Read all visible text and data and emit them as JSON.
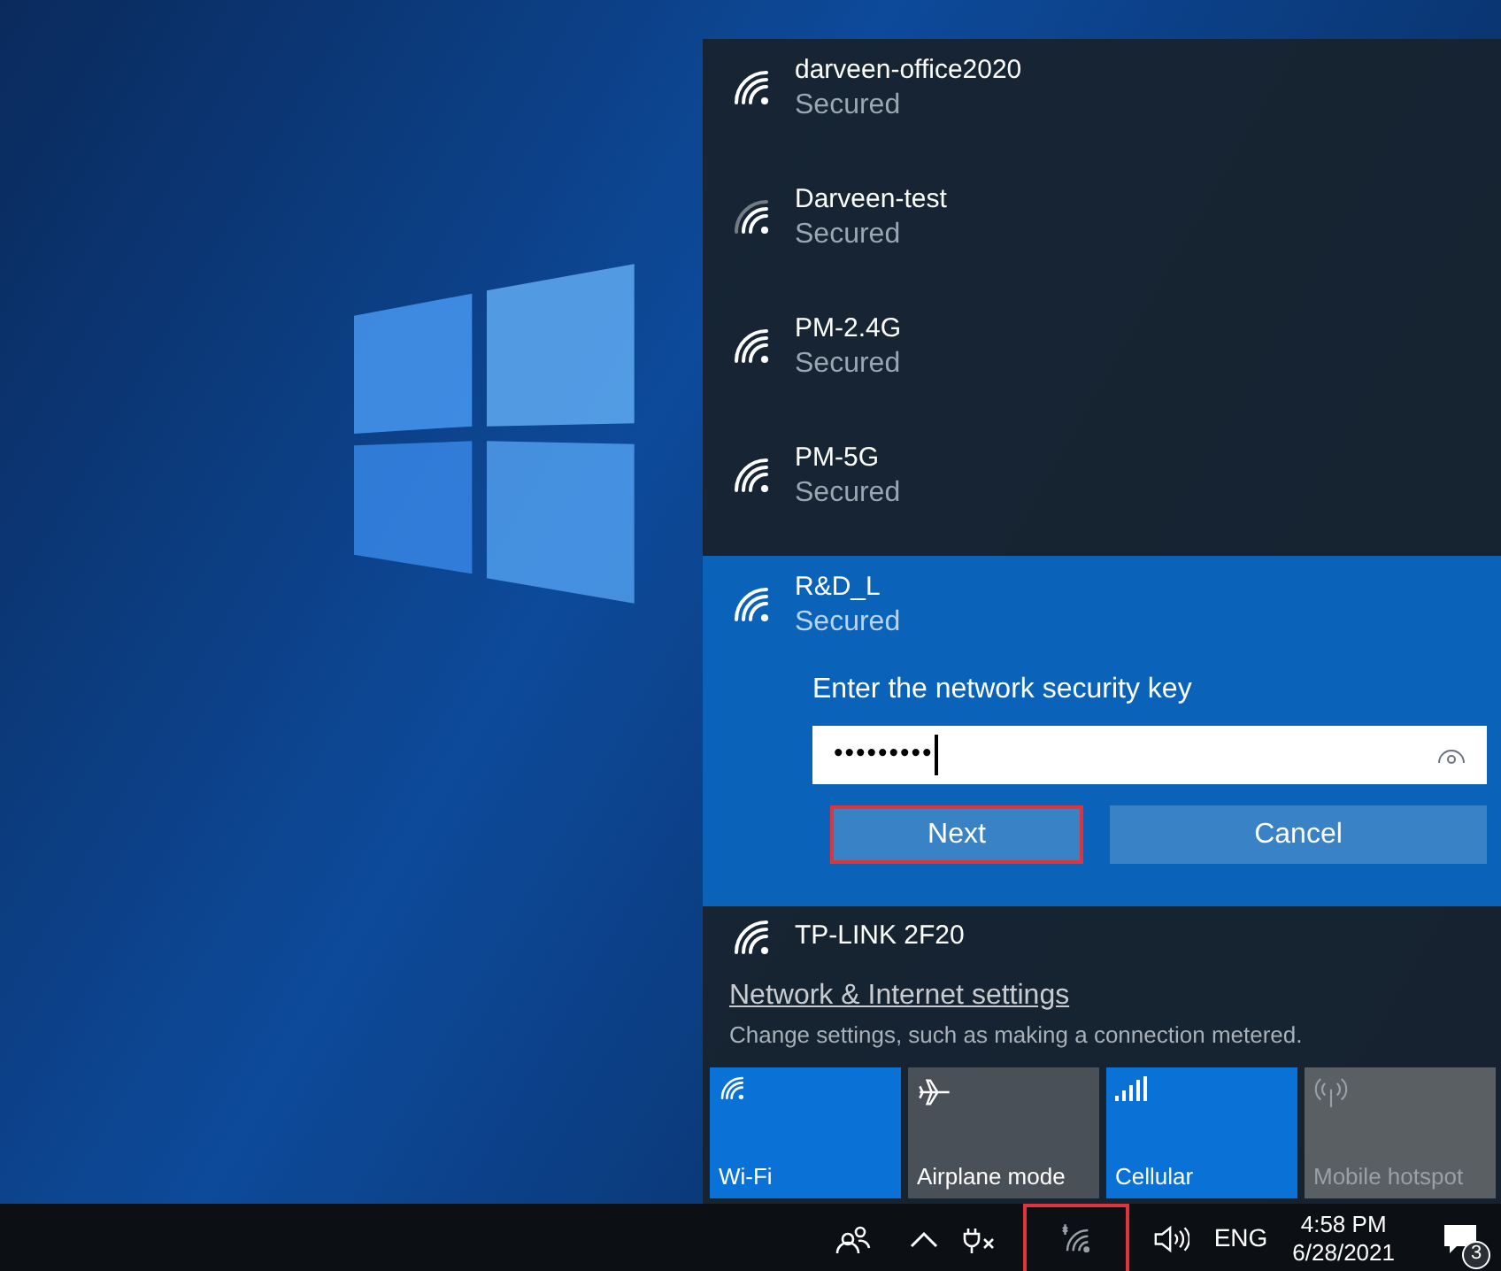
{
  "networks": [
    {
      "name": "darveen-office2020",
      "status": "Secured",
      "weak_signal": false
    },
    {
      "name": "Darveen-test",
      "status": "Secured",
      "weak_signal": true
    },
    {
      "name": "PM-2.4G",
      "status": "Secured",
      "weak_signal": false
    },
    {
      "name": "PM-5G",
      "status": "Secured",
      "weak_signal": false
    }
  ],
  "connecting": {
    "name": "R&D_L",
    "status": "Secured",
    "prompt": "Enter the network security key",
    "password": "•••••••••",
    "buttons": [
      {
        "label": "Next",
        "highlighted": true
      },
      {
        "label": "Cancel",
        "highlighted": false
      }
    ]
  },
  "next_network": {
    "name": "TP-LINK 2F20"
  },
  "settings": {
    "link": "Network & Internet settings",
    "description": "Change settings, such as making a connection metered."
  },
  "quick_actions": [
    {
      "kind": "wifi",
      "label": "Wi-Fi",
      "on": true,
      "disabled": false
    },
    {
      "kind": "airplane",
      "label": "Airplane mode",
      "on": false,
      "disabled": false
    },
    {
      "kind": "cellular",
      "label": "Cellular",
      "on": true,
      "disabled": false
    },
    {
      "kind": "hotspot",
      "label": "Mobile hotspot",
      "on": false,
      "disabled": true
    }
  ],
  "taskbar": {
    "network_highlighted": true,
    "language": "ENG",
    "time": "4:58 PM",
    "date": "6/28/2021",
    "notifications": "3"
  }
}
